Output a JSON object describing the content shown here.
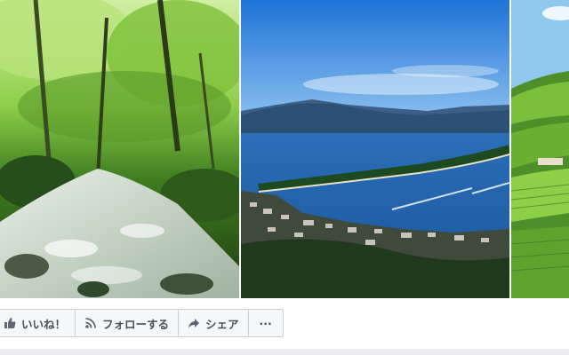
{
  "cover": {
    "photos": [
      {
        "name": "mountain stream in green forest"
      },
      {
        "name": "bay with pine sandbar and town"
      },
      {
        "name": "tea plantation hills"
      }
    ]
  },
  "actions": {
    "like_label": "いいね！",
    "follow_label": "フォローする",
    "share_label": "シェア",
    "more_label": "···"
  },
  "icons": {
    "like": "thumbs-up-icon",
    "follow": "rss-icon",
    "share": "share-arrow-icon",
    "more": "more-dots-icon"
  }
}
